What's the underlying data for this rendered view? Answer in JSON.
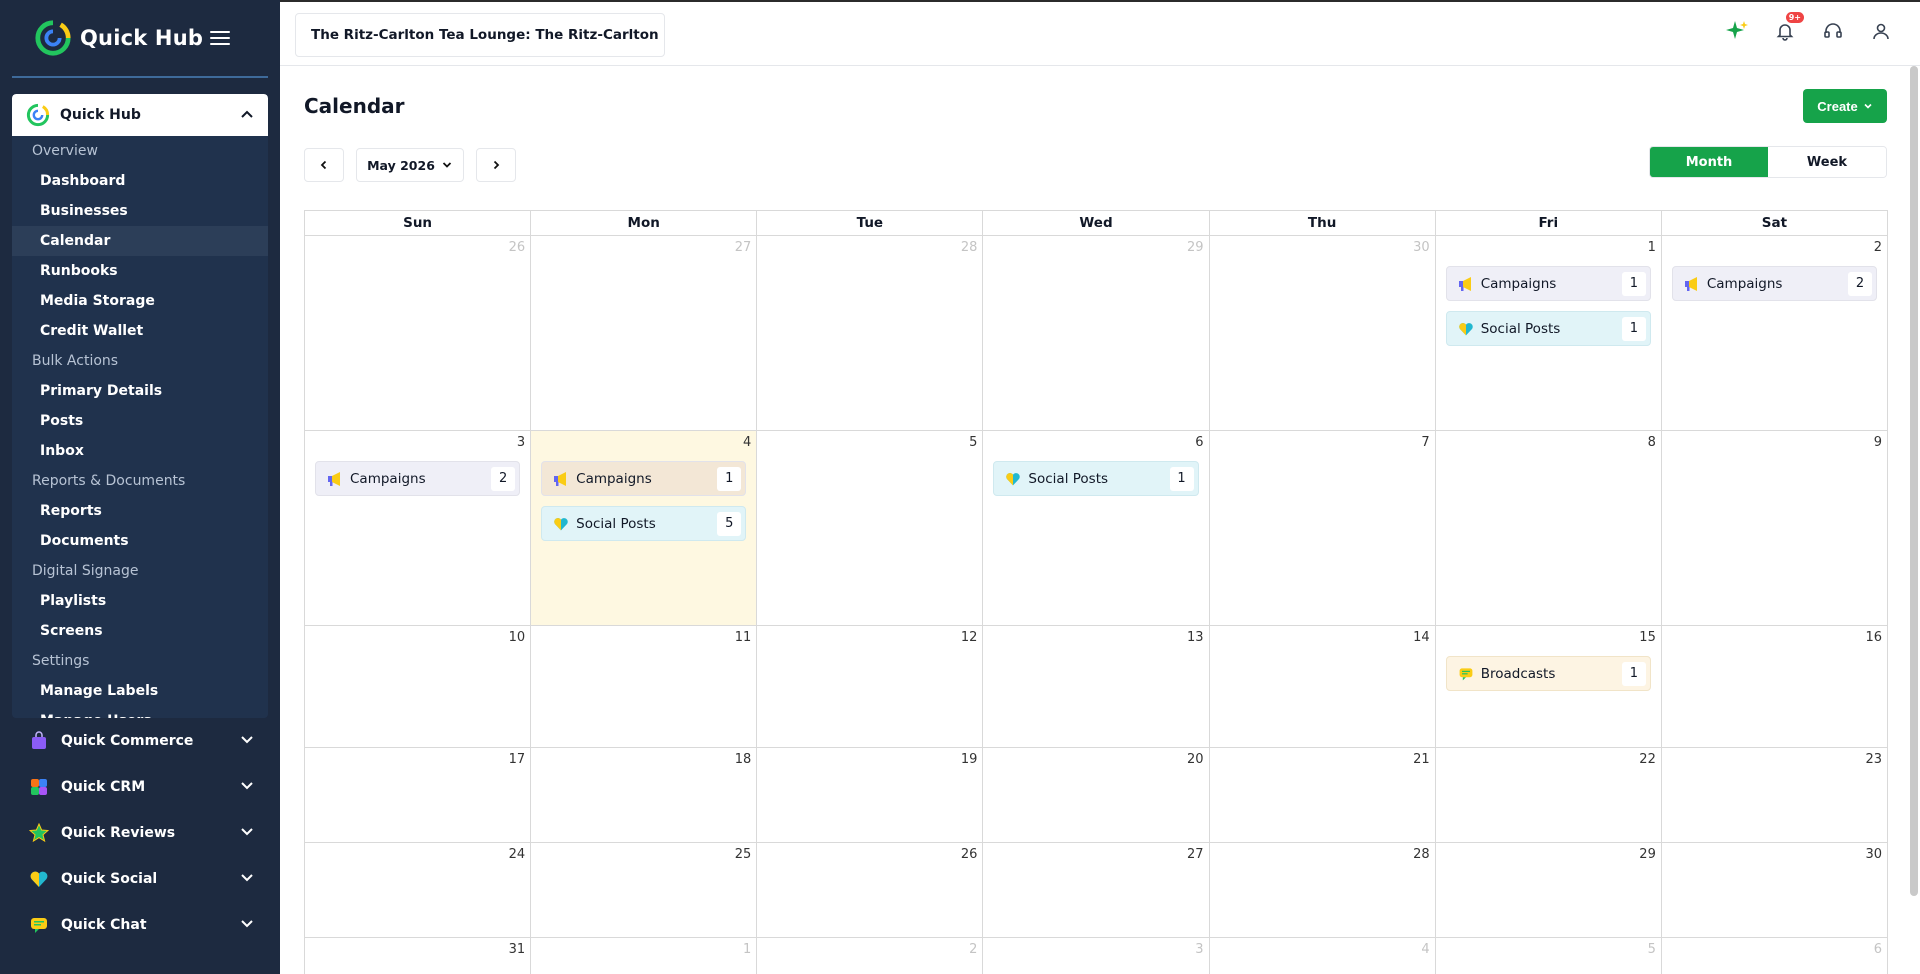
{
  "sidebar": {
    "brand": "Quick Hub",
    "hub": {
      "label": "Quick Hub",
      "sections": [
        {
          "group": "Overview",
          "items": [
            "Dashboard",
            "Businesses",
            "Calendar",
            "Runbooks",
            "Media Storage",
            "Credit Wallet"
          ]
        },
        {
          "group": "Bulk Actions",
          "items": [
            "Primary Details",
            "Posts",
            "Inbox"
          ]
        },
        {
          "group": "Reports & Documents",
          "items": [
            "Reports",
            "Documents"
          ]
        },
        {
          "group": "Digital Signage",
          "items": [
            "Playlists",
            "Screens"
          ]
        },
        {
          "group": "Settings",
          "items": [
            "Manage Labels",
            "Manage Users"
          ]
        }
      ],
      "active_item": "Calendar"
    },
    "products": [
      {
        "label": "Quick Commerce",
        "icon": "commerce-bag-icon"
      },
      {
        "label": "Quick CRM",
        "icon": "crm-icon"
      },
      {
        "label": "Quick Reviews",
        "icon": "reviews-star-icon"
      },
      {
        "label": "Quick Social",
        "icon": "social-heart-icon"
      },
      {
        "label": "Quick Chat",
        "icon": "chat-bubble-icon"
      }
    ]
  },
  "topbar": {
    "business_name": "The Ritz-Carlton Tea Lounge: The Ritz-Carlton",
    "notification_badge": "9+"
  },
  "page": {
    "title": "Calendar",
    "create_label": "Create",
    "month_label": "May 2026",
    "views": {
      "month": "Month",
      "week": "Week",
      "active": "month"
    }
  },
  "calendar": {
    "weekdays": [
      "Sun",
      "Mon",
      "Tue",
      "Wed",
      "Thu",
      "Fri",
      "Sat"
    ],
    "today": "4",
    "weeks": [
      [
        {
          "day": "26",
          "muted": true,
          "events": []
        },
        {
          "day": "27",
          "muted": true,
          "events": []
        },
        {
          "day": "28",
          "muted": true,
          "events": []
        },
        {
          "day": "29",
          "muted": true,
          "events": []
        },
        {
          "day": "30",
          "muted": true,
          "events": []
        },
        {
          "day": "1",
          "events": [
            {
              "type": "campaign",
              "label": "Campaigns",
              "count": "1"
            },
            {
              "type": "social",
              "label": "Social Posts",
              "count": "1"
            }
          ]
        },
        {
          "day": "2",
          "events": [
            {
              "type": "campaign",
              "label": "Campaigns",
              "count": "2"
            }
          ]
        }
      ],
      [
        {
          "day": "3",
          "events": [
            {
              "type": "campaign",
              "label": "Campaigns",
              "count": "2"
            }
          ]
        },
        {
          "day": "4",
          "today": true,
          "events": [
            {
              "type": "campaign",
              "label": "Campaigns",
              "count": "1"
            },
            {
              "type": "social",
              "label": "Social Posts",
              "count": "5"
            }
          ]
        },
        {
          "day": "5",
          "events": []
        },
        {
          "day": "6",
          "events": [
            {
              "type": "social",
              "label": "Social Posts",
              "count": "1"
            }
          ]
        },
        {
          "day": "7",
          "events": []
        },
        {
          "day": "8",
          "events": []
        },
        {
          "day": "9",
          "events": []
        }
      ],
      [
        {
          "day": "10",
          "events": []
        },
        {
          "day": "11",
          "events": []
        },
        {
          "day": "12",
          "events": []
        },
        {
          "day": "13",
          "events": []
        },
        {
          "day": "14",
          "events": []
        },
        {
          "day": "15",
          "events": [
            {
              "type": "broadcast",
              "label": "Broadcasts",
              "count": "1"
            }
          ]
        },
        {
          "day": "16",
          "events": []
        }
      ],
      [
        {
          "day": "17",
          "events": []
        },
        {
          "day": "18",
          "events": []
        },
        {
          "day": "19",
          "events": []
        },
        {
          "day": "20",
          "events": []
        },
        {
          "day": "21",
          "events": []
        },
        {
          "day": "22",
          "events": []
        },
        {
          "day": "23",
          "events": []
        }
      ],
      [
        {
          "day": "24",
          "events": []
        },
        {
          "day": "25",
          "events": []
        },
        {
          "day": "26",
          "events": []
        },
        {
          "day": "27",
          "events": []
        },
        {
          "day": "28",
          "events": []
        },
        {
          "day": "29",
          "events": []
        },
        {
          "day": "30",
          "events": []
        }
      ],
      [
        {
          "day": "31",
          "events": []
        },
        {
          "day": "1",
          "muted": true,
          "events": []
        },
        {
          "day": "2",
          "muted": true,
          "events": []
        },
        {
          "day": "3",
          "muted": true,
          "events": []
        },
        {
          "day": "4",
          "muted": true,
          "events": []
        },
        {
          "day": "5",
          "muted": true,
          "events": []
        },
        {
          "day": "6",
          "muted": true,
          "events": []
        }
      ]
    ]
  },
  "colors": {
    "accent": "#16a34a",
    "sidebar": "#1d2a40",
    "today": "#fef8e1"
  }
}
